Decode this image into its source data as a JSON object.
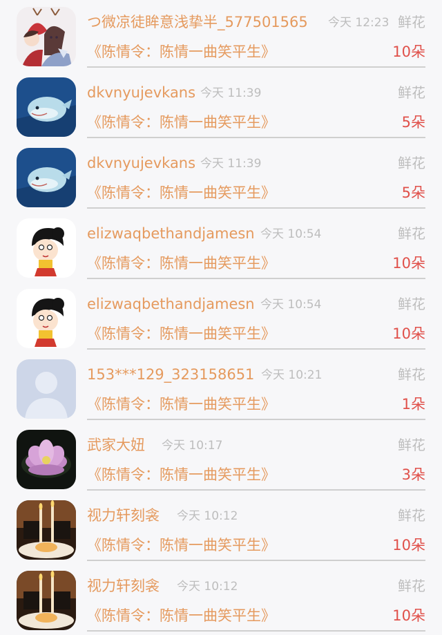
{
  "entries": [
    {
      "user": "つ微凉徒眸意浅挚半_577501565",
      "time": "今天 12:23",
      "gift": "鲜花",
      "book": "《陈情令：陈情一曲笑平生》",
      "count": "10朵",
      "avatar": "anime-couple-avatar"
    },
    {
      "user": "dkvnyujevkans",
      "time": "今天 11:39",
      "gift": "鲜花",
      "book": "《陈情令：陈情一曲笑平生》",
      "count": "5朵",
      "avatar": "whale-figurine-avatar"
    },
    {
      "user": "dkvnyujevkans",
      "time": "今天 11:39",
      "gift": "鲜花",
      "book": "《陈情令：陈情一曲笑平生》",
      "count": "5朵",
      "avatar": "whale-figurine-avatar"
    },
    {
      "user": "elizwaqbethandjamesn",
      "time": "今天 10:54",
      "gift": "鲜花",
      "book": "《陈情令：陈情一曲笑平生》",
      "count": "10朵",
      "avatar": "cartoon-girl-avatar"
    },
    {
      "user": "elizwaqbethandjamesn",
      "time": "今天 10:54",
      "gift": "鲜花",
      "book": "《陈情令：陈情一曲笑平生》",
      "count": "10朵",
      "avatar": "cartoon-girl-avatar"
    },
    {
      "user": "153***129_323158651",
      "time": "今天 10:21",
      "gift": "鲜花",
      "book": "《陈情令：陈情一曲笑平生》",
      "count": "1朵",
      "avatar": "default-user-avatar"
    },
    {
      "user": "武家大妞",
      "time": "今天 10:17",
      "gift": "鲜花",
      "book": "《陈情令：陈情一曲笑平生》",
      "count": "3朵",
      "avatar": "lotus-flower-avatar"
    },
    {
      "user": "视力轩刻衾",
      "time": "今天 10:12",
      "gift": "鲜花",
      "book": "《陈情令：陈情一曲笑平生》",
      "count": "10朵",
      "avatar": "candle-cake-avatar"
    },
    {
      "user": "视力轩刻衾",
      "time": "今天 10:12",
      "gift": "鲜花",
      "book": "《陈情令：陈情一曲笑平生》",
      "count": "10朵",
      "avatar": "candle-cake-avatar"
    }
  ],
  "colors": {
    "name": "#e59a5e",
    "count": "#e0504a",
    "muted": "#bdbdbd",
    "background": "#f7f7f9"
  }
}
